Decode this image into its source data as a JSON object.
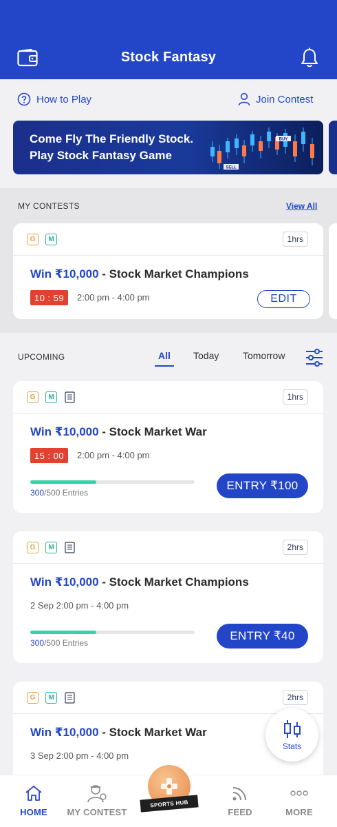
{
  "header": {
    "title": "Stock Fantasy",
    "wallet_icon": "wallet-icon",
    "bell_icon": "bell-icon"
  },
  "links": {
    "how_to_play": "How to Play",
    "join_contest": "Join Contest"
  },
  "banner": {
    "line1": "Come Fly The Friendly Stock.",
    "line2": "Play Stock Fantasy Game",
    "chart_buy": "BUY",
    "chart_sell": "SELL"
  },
  "my_contests": {
    "label": "MY CONTESTS",
    "view_all": "View All",
    "card": {
      "tag_g": "G",
      "tag_m": "M",
      "duration": "1hrs",
      "prize": "Win ₹10,000",
      "name": " - Stock Market Champions",
      "timer": "10 : 59",
      "time_range": "2:00 pm - 4:00 pm",
      "edit": "EDIT"
    }
  },
  "upcoming": {
    "label": "UPCOMING",
    "filters": [
      "All",
      "Today",
      "Tomorrow"
    ],
    "active_filter": "All",
    "cards": [
      {
        "tag_g": "G",
        "tag_m": "M",
        "duration": "1hrs",
        "prize": "Win ₹10,000",
        "name": " - Stock Market War",
        "timer": "15 : 00",
        "time_range": "2:00 pm - 4:00 pm",
        "progress": 0.4,
        "entries_filled": "300",
        "entries_rest": "/500 Entries",
        "entry": "ENTRY ₹100"
      },
      {
        "tag_g": "G",
        "tag_m": "M",
        "duration": "2hrs",
        "prize": "Win ₹10,000",
        "name": " - Stock Market Champions",
        "time_range": "2 Sep 2:00 pm - 4:00 pm",
        "progress": 0.4,
        "entries_filled": "300",
        "entries_rest": "/500 Entries",
        "entry": "ENTRY ₹40"
      },
      {
        "tag_g": "G",
        "tag_m": "M",
        "duration": "2hrs",
        "prize": "Win ₹10,000",
        "name": " - Stock Market War",
        "time_range": "3 Sep 2:00 pm - 4:00 pm"
      }
    ]
  },
  "stats_fab": {
    "label": "Stats"
  },
  "bottom_nav": {
    "home": "HOME",
    "my_contest": "MY CONTEST",
    "sports_hub": "SPORTS HUB",
    "feed": "FEED",
    "more": "MORE",
    "active": "HOME"
  },
  "colors": {
    "primary": "#2346c9",
    "timer": "#e2412f",
    "progress": "#36d3a7",
    "tag_g": "#e6a23c",
    "tag_m": "#2bb39a"
  }
}
